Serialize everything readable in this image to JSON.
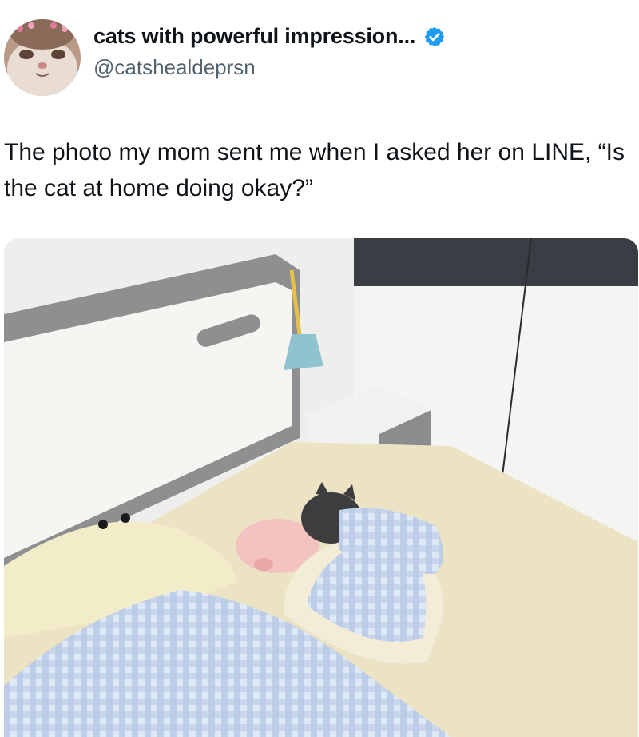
{
  "author": {
    "display_name": "cats with powerful impression...",
    "handle": "@catshealdeprsn",
    "verified": true,
    "verified_badge_color": "#1d9bf0",
    "avatar_icon": "cat-face-avatar"
  },
  "tweet": {
    "text": "The photo my mom sent me when I asked her on LINE, “Is the cat at home doing okay?”"
  },
  "media": {
    "kind": "photo",
    "icon": "cat-in-bed-photo"
  },
  "colors": {
    "text_primary": "#0f1419",
    "text_secondary": "#536471",
    "accent": "#1d9bf0"
  }
}
